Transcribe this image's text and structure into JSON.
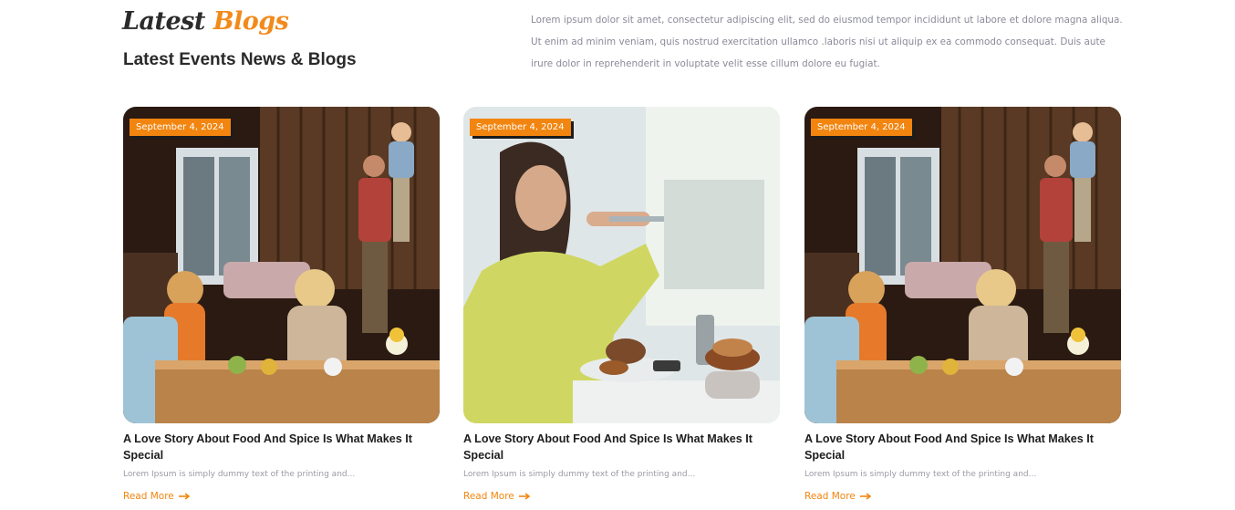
{
  "header": {
    "script_title_part1": "Latest",
    "script_title_part2": "Blogs",
    "subtitle": "Latest Events News & Blogs",
    "intro": "Lorem ipsum dolor sit amet, consectetur adipiscing elit, sed do eiusmod tempor incididunt ut labore et dolore magna aliqua. Ut enim ad minim veniam, quis nostrud exercitation ullamco .laboris nisi ut aliquip ex ea commodo consequat. Duis aute irure dolor in reprehenderit in voluptate velit esse cillum dolore eu fugiat."
  },
  "cards": [
    {
      "date": "September 4, 2024",
      "title": "A Love Story About Food And Spice Is What Makes It Special",
      "excerpt": "Lorem Ipsum is simply dummy text of the printing and...",
      "read_more": "Read More",
      "image": "family-dinner-photo"
    },
    {
      "date": "September 4, 2024",
      "title": "A Love Story About Food And Spice Is What Makes It Special",
      "excerpt": "Lorem Ipsum is simply dummy text of the printing and...",
      "read_more": "Read More",
      "image": "woman-photographing-food-photo"
    },
    {
      "date": "September 4, 2024",
      "title": "A Love Story About Food And Spice Is What Makes It Special",
      "excerpt": "Lorem Ipsum is simply dummy text of the printing and...",
      "read_more": "Read More",
      "image": "family-dinner-photo"
    }
  ],
  "colors": {
    "accent": "#f2850f",
    "heading": "#2a2a2a",
    "muted": "#8a8a99"
  }
}
